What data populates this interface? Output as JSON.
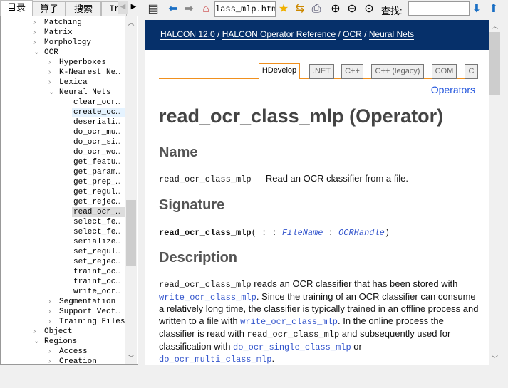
{
  "left_tabs": [
    "目录",
    "算子",
    "搜索",
    "In"
  ],
  "tree": [
    {
      "label": "Matching",
      "level": 1,
      "state": "collapsed"
    },
    {
      "label": "Matrix",
      "level": 1,
      "state": "collapsed"
    },
    {
      "label": "Morphology",
      "level": 1,
      "state": "collapsed"
    },
    {
      "label": "OCR",
      "level": 1,
      "state": "expanded"
    },
    {
      "label": "Hyperboxes",
      "level": 2,
      "state": "collapsed"
    },
    {
      "label": "K-Nearest Ne…",
      "level": 2,
      "state": "collapsed"
    },
    {
      "label": "Lexica",
      "level": 2,
      "state": "collapsed"
    },
    {
      "label": "Neural Nets",
      "level": 2,
      "state": "expanded"
    },
    {
      "label": "clear_ocr…",
      "level": 3
    },
    {
      "label": "create_oc…",
      "level": 3,
      "hover": true
    },
    {
      "label": "deseriali…",
      "level": 3
    },
    {
      "label": "do_ocr_mu…",
      "level": 3
    },
    {
      "label": "do_ocr_si…",
      "level": 3
    },
    {
      "label": "do_ocr_wo…",
      "level": 3
    },
    {
      "label": "get_featu…",
      "level": 3
    },
    {
      "label": "get_param…",
      "level": 3
    },
    {
      "label": "get_prep_…",
      "level": 3
    },
    {
      "label": "get_regul…",
      "level": 3
    },
    {
      "label": "get_rejec…",
      "level": 3
    },
    {
      "label": "read_ocr_…",
      "level": 3,
      "selected": true
    },
    {
      "label": "select_fe…",
      "level": 3
    },
    {
      "label": "select_fe…",
      "level": 3
    },
    {
      "label": "serialize…",
      "level": 3
    },
    {
      "label": "set_regul…",
      "level": 3
    },
    {
      "label": "set_rejec…",
      "level": 3
    },
    {
      "label": "trainf_oc…",
      "level": 3
    },
    {
      "label": "trainf_oc…",
      "level": 3
    },
    {
      "label": "write_ocr…",
      "level": 3
    },
    {
      "label": "Segmentation",
      "level": 2,
      "state": "collapsed"
    },
    {
      "label": "Support Vect…",
      "level": 2,
      "state": "collapsed"
    },
    {
      "label": "Training Files",
      "level": 2,
      "state": "collapsed"
    },
    {
      "label": "Object",
      "level": 1,
      "state": "collapsed"
    },
    {
      "label": "Regions",
      "level": 1,
      "state": "expanded"
    },
    {
      "label": "Access",
      "level": 2,
      "state": "collapsed"
    },
    {
      "label": "Creation",
      "level": 2,
      "state": "collapsed"
    }
  ],
  "toolbar": {
    "address": "lass_mlp.html",
    "find_label": "查找:",
    "find_value": ""
  },
  "breadcrumb": [
    "HALCON 12.0",
    "HALCON Operator Reference",
    "OCR",
    "Neural Nets"
  ],
  "lang_tabs": [
    "HDevelop",
    ".NET",
    "C++",
    "C++ (legacy)",
    "COM",
    "C"
  ],
  "operators_link": "Operators",
  "title": "read_ocr_class_mlp (Operator)",
  "name_heading": "Name",
  "name_op": "read_ocr_class_mlp",
  "name_desc": " — Read an OCR classifier from a file.",
  "signature_heading": "Signature",
  "sig": {
    "op": "read_ocr_class_mlp",
    "open": "( : : ",
    "p1": "FileName",
    "sep": " : ",
    "p2": "OCRHandle",
    "close": ")"
  },
  "description_heading": "Description",
  "desc": {
    "t1": "read_ocr_class_mlp",
    "t2": " reads an OCR classifier that has been stored with ",
    "l1": "write_ocr_class_mlp",
    "t3": ". Since the training of an OCR classifier can consume a relatively long time, the classifier is typically trained in an offline process and written to a file with ",
    "l2": "write_ocr_class_mlp",
    "t4": ". In the online process the classifier is read with ",
    "t5": "read_ocr_class_mlp",
    "t6": " and subsequently used for classification with ",
    "l3": "do_ocr_single_class_mlp",
    "t7": " or ",
    "l4": "do_ocr_multi_class_mlp",
    "t8": "."
  },
  "colors": {
    "header": "#06306a",
    "active_tab": "#f0901e",
    "link": "#3355cc"
  }
}
